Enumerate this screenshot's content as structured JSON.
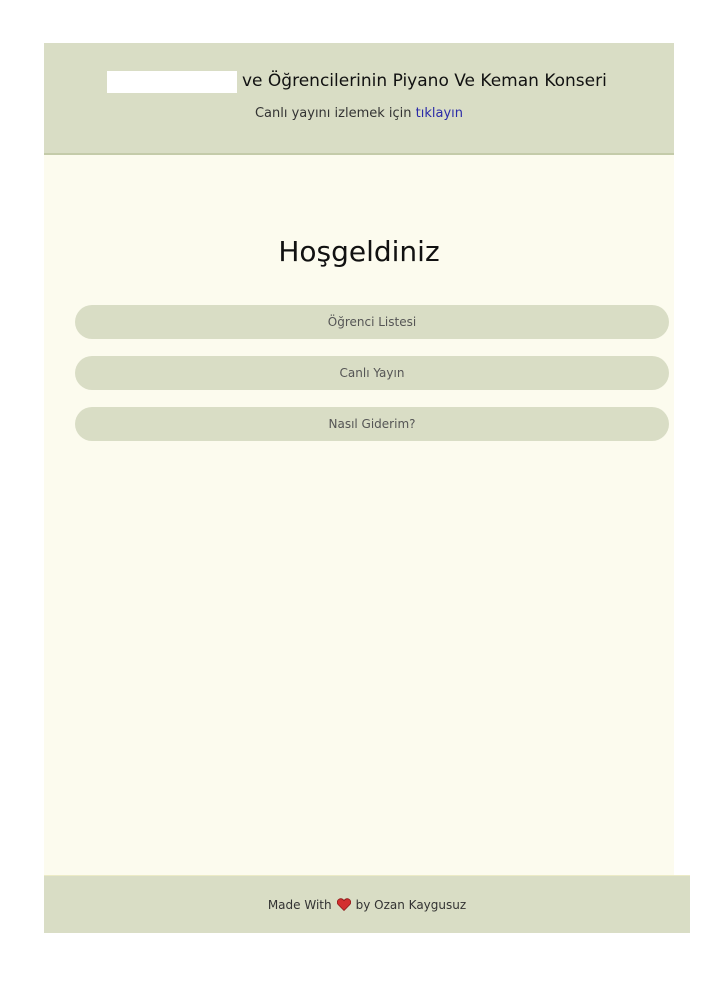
{
  "header": {
    "title": "ve Öğrencilerinin Piyano Ve Keman Konseri",
    "subtitle_text": "Canlı yayını izlemek için",
    "subtitle_link": "tıklayın"
  },
  "main": {
    "welcome": "Hoşgeldiniz",
    "buttons": [
      {
        "label": "Öğrenci Listesi"
      },
      {
        "label": "Canlı Yayın"
      },
      {
        "label": "Nasıl Giderim?"
      }
    ]
  },
  "footer": {
    "prefix": "Made With",
    "icon": "heart-icon",
    "suffix": "by Ozan Kaygusuz"
  },
  "colors": {
    "header_bg": "#d9ddc5",
    "main_bg": "#fcfbee",
    "link": "#2a2aa8",
    "heart": "#d32f2f"
  }
}
